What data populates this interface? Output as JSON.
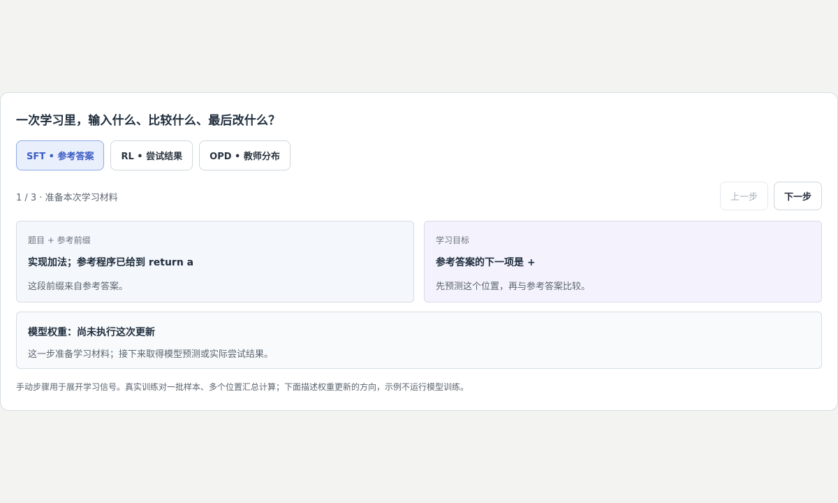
{
  "header": {
    "title": "一次学习里，输入什么、比较什么、最后改什么？"
  },
  "tabs": [
    {
      "label": "SFT • 参考答案",
      "active": true
    },
    {
      "label": "RL • 尝试结果",
      "active": false
    },
    {
      "label": "OPD • 教师分布",
      "active": false
    }
  ],
  "stepper": {
    "progress": "1 / 3 · 准备本次学习材料",
    "prev_label": "上一步",
    "next_label": "下一步"
  },
  "panels": {
    "left": {
      "label": "题目 + 参考前缀",
      "heading": "实现加法；参考程序已给到 return a",
      "description": "这段前缀来自参考答案。"
    },
    "right": {
      "label": "学习目标",
      "heading": "参考答案的下一项是 +",
      "description": "先预测这个位置，再与参考答案比较。"
    },
    "bottom": {
      "heading": "模型权重：尚未执行这次更新",
      "description": "这一步准备学习材料；接下来取得模型预测或实际尝试结果。"
    }
  },
  "footnote": "手动步骤用于展开学习信号。真实训练对一批样本、多个位置汇总计算；下面描述权重更新的方向，示例不运行模型训练。",
  "colors": {
    "accent": "#3b5bc5",
    "active_tab_bg": "#e9effb",
    "panel_right_bg": "#f4f3fd"
  }
}
